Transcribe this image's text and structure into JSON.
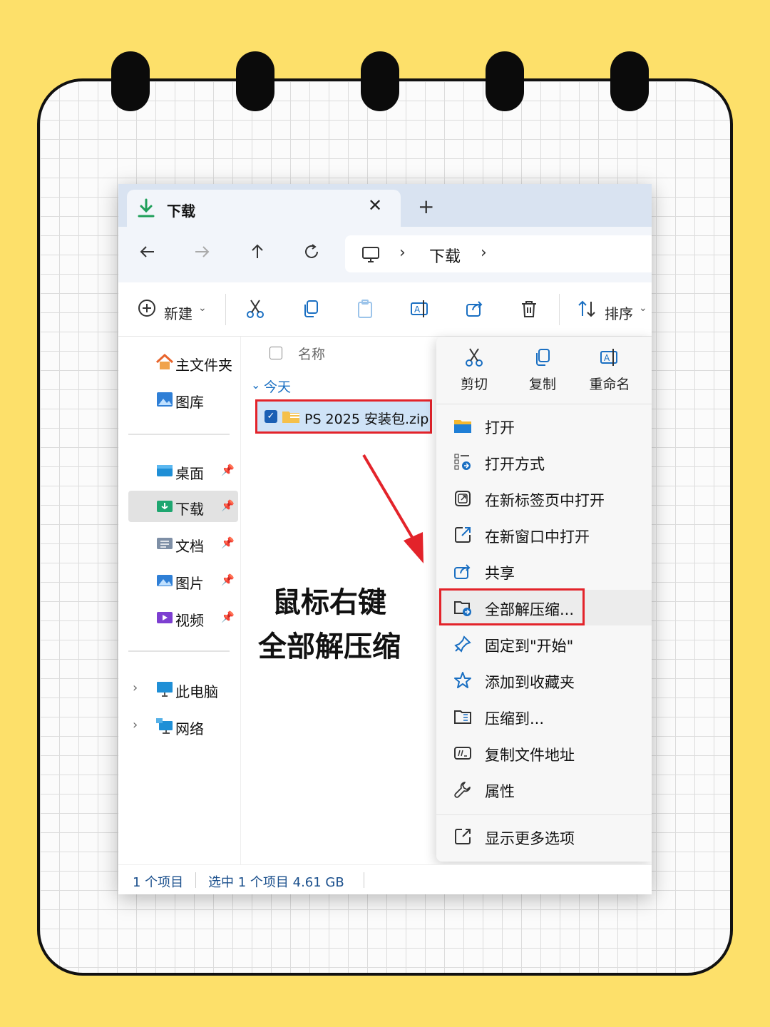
{
  "window": {
    "tab_title": "下载",
    "tab_close": "✕",
    "tab_add": "+"
  },
  "address": {
    "path_current": "下载"
  },
  "toolbar": {
    "new_label": "新建",
    "sort_label": "排序"
  },
  "sidebar": {
    "items": [
      {
        "label": "主文件夹"
      },
      {
        "label": "图库"
      },
      {
        "label": "桌面"
      },
      {
        "label": "下载"
      },
      {
        "label": "文档"
      },
      {
        "label": "图片"
      },
      {
        "label": "视频"
      },
      {
        "label": "此电脑"
      },
      {
        "label": "网络"
      }
    ]
  },
  "filelist": {
    "column_name": "名称",
    "group": "今天",
    "file": {
      "name": "PS 2025 安装包.zip",
      "selected": true
    }
  },
  "annotation": {
    "line1": "鼠标右键",
    "line2": "全部解压缩"
  },
  "status": {
    "items_count": "1 个项目",
    "selected": "选中 1 个项目  4.61 GB"
  },
  "context_menu": {
    "top": [
      {
        "label": "剪切",
        "icon": "scissors-icon"
      },
      {
        "label": "复制",
        "icon": "copy-icon"
      },
      {
        "label": "重命名",
        "icon": "rename-icon"
      }
    ],
    "items": [
      {
        "label": "打开",
        "icon": "folder-icon"
      },
      {
        "label": "打开方式",
        "icon": "open-with-icon"
      },
      {
        "label": "在新标签页中打开",
        "icon": "new-tab-icon"
      },
      {
        "label": "在新窗口中打开",
        "icon": "new-window-icon"
      },
      {
        "label": "共享",
        "icon": "share-icon"
      },
      {
        "label": "全部解压缩...",
        "icon": "extract-icon"
      },
      {
        "label": "固定到\"开始\"",
        "icon": "pin-icon"
      },
      {
        "label": "添加到收藏夹",
        "icon": "star-icon"
      },
      {
        "label": "压缩到...",
        "icon": "compress-icon"
      },
      {
        "label": "复制文件地址",
        "icon": "copy-path-icon"
      },
      {
        "label": "属性",
        "icon": "wrench-icon"
      }
    ],
    "more": {
      "label": "显示更多选项",
      "icon": "more-options-icon"
    }
  },
  "colors": {
    "background": "#fde06a",
    "highlight_red": "#e3232a",
    "accent_blue": "#1a6fc2"
  }
}
